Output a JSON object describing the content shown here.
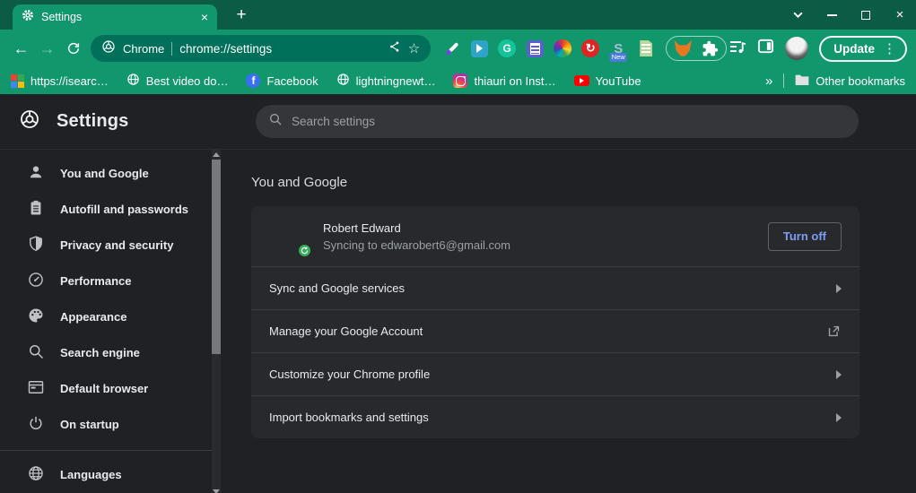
{
  "colors": {
    "frame_green": "#0c5b44",
    "toolbar_green": "#12976c",
    "omnibox_green": "#00705a",
    "page_bg": "#202124",
    "card_bg": "#28292c",
    "accent_blue": "#7f9cf5",
    "sync_badge_green": "#35ad5c"
  },
  "tab_bar": {
    "tab_title": "Settings"
  },
  "toolbar": {
    "site_label": "Chrome",
    "url": "chrome://settings",
    "update_label": "Update",
    "icons": {
      "grammarly_letter": "G",
      "s_letter": "S",
      "new_badge": "New",
      "red_glyph": "↻"
    }
  },
  "bookmarks": {
    "items": [
      {
        "icon": "mosaic-favicon",
        "label": "https://isearc…"
      },
      {
        "icon": "globe-favicon",
        "label": "Best video do…"
      },
      {
        "icon": "facebook-favicon",
        "label": "Facebook",
        "letter": "f"
      },
      {
        "icon": "globe-favicon",
        "label": "lightningnewt…"
      },
      {
        "icon": "instagram-favicon",
        "label": "thiauri on Inst…"
      },
      {
        "icon": "youtube-favicon",
        "label": "YouTube"
      }
    ],
    "overflow_chevron": "»",
    "other_bookmarks": "Other bookmarks"
  },
  "settings_header": {
    "title": "Settings",
    "search_placeholder": "Search settings"
  },
  "sidebar": {
    "items": [
      {
        "icon": "person",
        "label": "You and Google"
      },
      {
        "icon": "clipboard",
        "label": "Autofill and passwords"
      },
      {
        "icon": "shield",
        "label": "Privacy and security"
      },
      {
        "icon": "speedometer",
        "label": "Performance"
      },
      {
        "icon": "palette",
        "label": "Appearance"
      },
      {
        "icon": "magnifier",
        "label": "Search engine"
      },
      {
        "icon": "browser-window",
        "label": "Default browser"
      },
      {
        "icon": "power",
        "label": "On startup"
      },
      {
        "icon": "globe",
        "label": "Languages"
      }
    ]
  },
  "main": {
    "section_title": "You and Google",
    "profile": {
      "name": "Robert Edward",
      "sync_status": "Syncing to edwarobert6@gmail.com",
      "turn_off_label": "Turn off"
    },
    "rows": [
      {
        "label": "Sync and Google services",
        "trailing": "arrow"
      },
      {
        "label": "Manage your Google Account",
        "trailing": "external-link"
      },
      {
        "label": "Customize your Chrome profile",
        "trailing": "arrow"
      },
      {
        "label": "Import bookmarks and settings",
        "trailing": "arrow"
      }
    ]
  }
}
